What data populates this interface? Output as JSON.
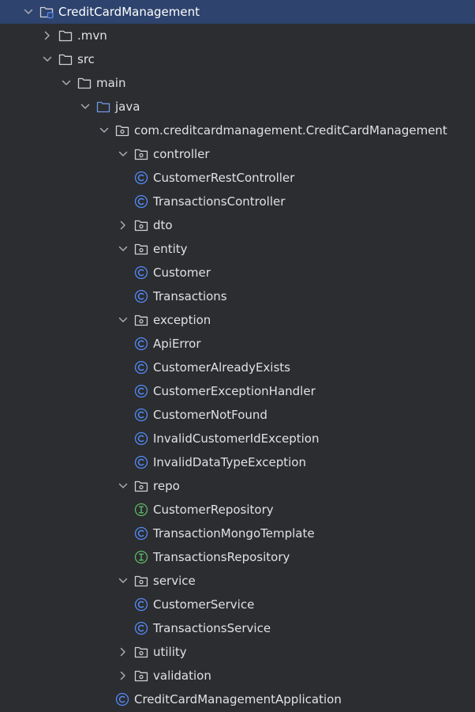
{
  "colors": {
    "background": "#2b2d30",
    "selection": "#2e436e",
    "text": "#dfe1e5",
    "chevron": "#a8adb3",
    "folder": "#cfd1d4",
    "source_folder": "#6f97e6",
    "class_icon": "#548af7",
    "interface_icon": "#5fb865"
  },
  "tree": {
    "root": {
      "label": "CreditCardManagement",
      "icon": "module-folder-icon",
      "expanded": true
    },
    "mvn": {
      "label": ".mvn",
      "icon": "folder-icon",
      "expanded": false
    },
    "src": {
      "label": "src",
      "icon": "folder-icon",
      "expanded": true
    },
    "main": {
      "label": "main",
      "icon": "folder-icon",
      "expanded": true
    },
    "java": {
      "label": "java",
      "icon": "source-root-folder-icon",
      "expanded": true
    },
    "package": {
      "label": "com.creditcardmanagement.CreditCardManagement",
      "icon": "package-icon",
      "expanded": true
    },
    "controller": {
      "label": "controller",
      "icon": "package-icon",
      "expanded": true
    },
    "customer_rest_controller": {
      "label": "CustomerRestController",
      "icon": "class-icon"
    },
    "transactions_controller": {
      "label": "TransactionsController",
      "icon": "class-icon"
    },
    "dto": {
      "label": "dto",
      "icon": "package-icon",
      "expanded": false
    },
    "entity": {
      "label": "entity",
      "icon": "package-icon",
      "expanded": true
    },
    "customer": {
      "label": "Customer",
      "icon": "class-icon"
    },
    "transactions": {
      "label": "Transactions",
      "icon": "class-icon"
    },
    "exception": {
      "label": "exception",
      "icon": "package-icon",
      "expanded": true
    },
    "api_error": {
      "label": "ApiError",
      "icon": "class-icon"
    },
    "customer_already_exists": {
      "label": "CustomerAlreadyExists",
      "icon": "class-icon"
    },
    "customer_exception_handler": {
      "label": "CustomerExceptionHandler",
      "icon": "class-icon"
    },
    "customer_not_found": {
      "label": "CustomerNotFound",
      "icon": "class-icon"
    },
    "invalid_customer_id_exception": {
      "label": "InvalidCustomerIdException",
      "icon": "class-icon"
    },
    "invalid_data_type_exception": {
      "label": "InvalidDataTypeException",
      "icon": "class-icon"
    },
    "repo": {
      "label": "repo",
      "icon": "package-icon",
      "expanded": true
    },
    "customer_repository": {
      "label": "CustomerRepository",
      "icon": "interface-icon"
    },
    "transaction_mongo_template": {
      "label": "TransactionMongoTemplate",
      "icon": "class-icon"
    },
    "transactions_repository": {
      "label": "TransactionsRepository",
      "icon": "interface-icon"
    },
    "service": {
      "label": "service",
      "icon": "package-icon",
      "expanded": true
    },
    "customer_service": {
      "label": "CustomerService",
      "icon": "class-icon"
    },
    "transactions_service": {
      "label": "TransactionsService",
      "icon": "class-icon"
    },
    "utility": {
      "label": "utility",
      "icon": "package-icon",
      "expanded": false
    },
    "validation": {
      "label": "validation",
      "icon": "package-icon",
      "expanded": false
    },
    "application": {
      "label": "CreditCardManagementApplication",
      "icon": "class-icon"
    }
  }
}
